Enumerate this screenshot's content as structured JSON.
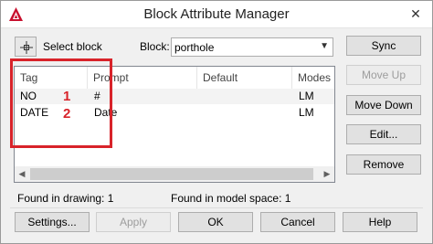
{
  "window": {
    "title": "Block Attribute Manager",
    "close_glyph": "✕"
  },
  "toolbar": {
    "select_block_label": "Select block",
    "block_label": "Block:",
    "block_value": "porthole",
    "sync_label": "Sync"
  },
  "table": {
    "columns": [
      "Tag",
      "Prompt",
      "Default",
      "Modes"
    ],
    "rows": [
      {
        "tag": "NO",
        "prompt": "#",
        "default": "",
        "modes": "LM"
      },
      {
        "tag": "DATE",
        "prompt": "Date",
        "default": "",
        "modes": "LM"
      }
    ]
  },
  "annotations": {
    "num1": "1",
    "num2": "2",
    "color": "#d8232a"
  },
  "side_buttons": {
    "move_up": "Move Up",
    "move_down": "Move Down",
    "edit": "Edit...",
    "remove": "Remove"
  },
  "status": {
    "found_in_drawing": "Found in drawing: 1",
    "found_in_model_space": "Found in model space: 1"
  },
  "footer": {
    "settings": "Settings...",
    "apply": "Apply",
    "ok": "OK",
    "cancel": "Cancel",
    "help": "Help"
  }
}
